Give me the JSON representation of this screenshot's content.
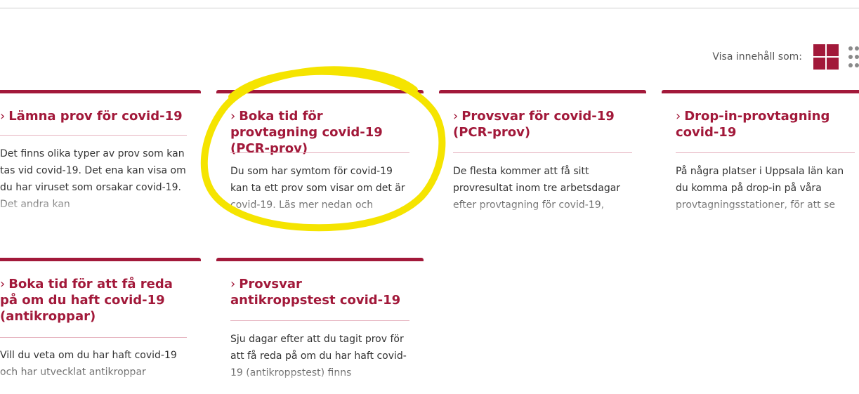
{
  "view_toggle": {
    "label": "Visa innehåll som:",
    "grid_icon": "grid-view-icon",
    "list_icon": "list-view-icon",
    "active": "grid"
  },
  "colors": {
    "accent": "#a2193a",
    "divider": "#e6b4c0",
    "highlight": "#f5e400"
  },
  "chevron": "›",
  "cards": [
    {
      "title": "Lämna prov för covid-19",
      "description": "Det finns olika typer av prov som kan tas vid covid-19. Det ena kan visa om du har viruset som orsakar covid-19. Det andra kan"
    },
    {
      "title": "Boka tid för provtagning covid-19 (PCR-prov)",
      "description": "Du som har symtom för covid-19 kan ta ett prov som visar om det är covid-19. Läs mer nedan och",
      "highlighted": true
    },
    {
      "title": "Provsvar för covid-19 (PCR-prov)",
      "description": "De flesta kommer att få sitt provresultat inom tre arbetsdagar efter provtagning för covid-19,"
    },
    {
      "title": "Drop-in-provtagning covid-19",
      "description": "På några platser i Uppsala län kan du komma på drop-in på våra provtagningsstationer, för att se"
    },
    {
      "title": "Boka tid för att få reda på om du haft covid-19 (antikroppar)",
      "description": "Vill du veta om du har haft covid-19 och har utvecklat antikroppar"
    },
    {
      "title": "Provsvar antikroppstest covid-19",
      "description": "Sju dagar efter att du tagit prov för att få reda på om du har haft covid-19 (antikroppstest) finns"
    }
  ]
}
